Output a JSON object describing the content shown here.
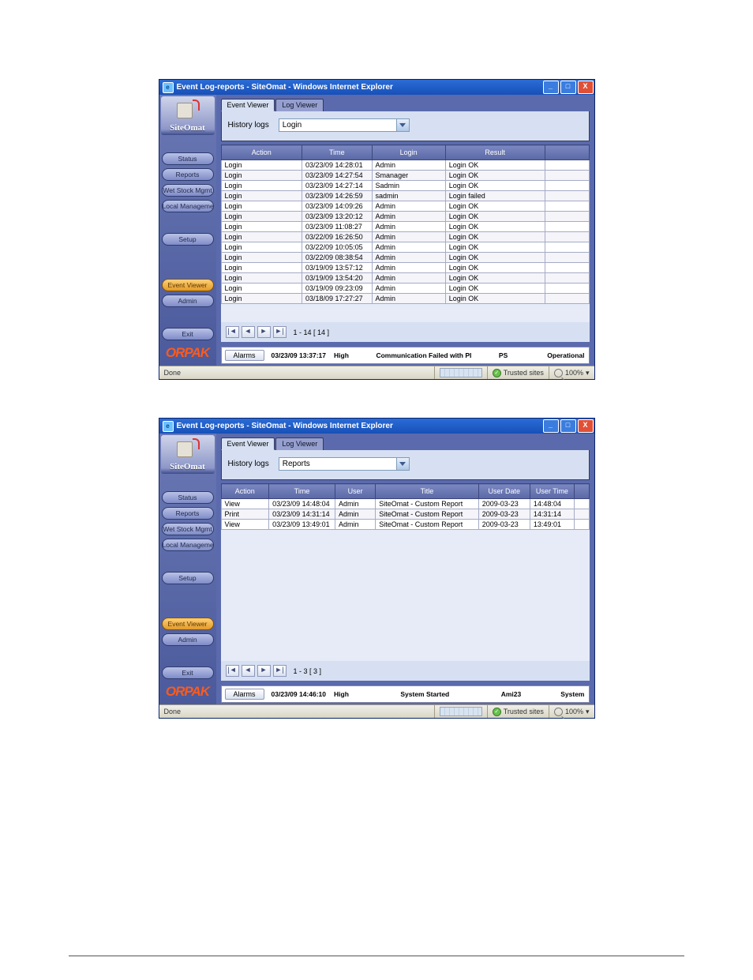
{
  "windowA": {
    "title": "Event Log-reports - SiteOmat - Windows Internet Explorer",
    "logo": "SiteOmat",
    "brand": "ORPAK",
    "nav": [
      "Status",
      "Reports",
      "Wet Stock Mgmt",
      "Local Management",
      "Setup",
      "Event Viewer",
      "Admin",
      "Exit"
    ],
    "navActiveIndex": 5,
    "tabs": [
      "Event Viewer",
      "Log Viewer"
    ],
    "tabActiveIndex": 0,
    "filterLabel": "History logs",
    "dropdownValue": "Login",
    "columns": [
      "Action",
      "Time",
      "Login",
      "Result"
    ],
    "rows": [
      [
        "Login",
        "03/23/09 14:28:01",
        "Admin",
        "Login OK"
      ],
      [
        "Login",
        "03/23/09 14:27:54",
        "Smanager",
        "Login OK"
      ],
      [
        "Login",
        "03/23/09 14:27:14",
        "Sadmin",
        "Login OK"
      ],
      [
        "Login",
        "03/23/09 14:26:59",
        "sadmin",
        "Login failed"
      ],
      [
        "Login",
        "03/23/09 14:09:26",
        "Admin",
        "Login OK"
      ],
      [
        "Login",
        "03/23/09 13:20:12",
        "Admin",
        "Login OK"
      ],
      [
        "Login",
        "03/23/09 11:08:27",
        "Admin",
        "Login OK"
      ],
      [
        "Login",
        "03/22/09 16:26:50",
        "Admin",
        "Login OK"
      ],
      [
        "Login",
        "03/22/09 10:05:05",
        "Admin",
        "Login OK"
      ],
      [
        "Login",
        "03/22/09 08:38:54",
        "Admin",
        "Login OK"
      ],
      [
        "Login",
        "03/19/09 13:57:12",
        "Admin",
        "Login OK"
      ],
      [
        "Login",
        "03/19/09 13:54:20",
        "Admin",
        "Login OK"
      ],
      [
        "Login",
        "03/19/09 09:23:09",
        "Admin",
        "Login OK"
      ],
      [
        "Login",
        "03/18/09 17:27:27",
        "Admin",
        "Login OK"
      ]
    ],
    "pager": {
      "first": "|◄",
      "prev": "◄",
      "next": "►",
      "last": "►|",
      "range": "1 - 14  [ 14 ]"
    },
    "alarm": {
      "btn": "Alarms",
      "time": "03/23/09 13:37:17",
      "sev": "High",
      "msg": "Communication Failed with PI",
      "dev": "PS",
      "cat": "Operational"
    },
    "ie": {
      "done": "Done",
      "trusted": "Trusted sites",
      "zoom": "100%"
    }
  },
  "windowB": {
    "title": "Event Log-reports - SiteOmat - Windows Internet Explorer",
    "logo": "SiteOmat",
    "brand": "ORPAK",
    "nav": [
      "Status",
      "Reports",
      "Wet Stock Mgmt",
      "Local Management",
      "Setup",
      "Event Viewer",
      "Admin",
      "Exit"
    ],
    "navActiveIndex": 5,
    "tabs": [
      "Event Viewer",
      "Log Viewer"
    ],
    "tabActiveIndex": 0,
    "filterLabel": "History logs",
    "dropdownValue": "Reports",
    "columns": [
      "Action",
      "Time",
      "User",
      "Title",
      "User Date",
      "User Time"
    ],
    "rows": [
      [
        "View",
        "03/23/09 14:48:04",
        "Admin",
        "SiteOmat - Custom Report",
        "2009-03-23",
        "14:48:04"
      ],
      [
        "Print",
        "03/23/09 14:31:14",
        "Admin",
        "SiteOmat - Custom Report",
        "2009-03-23",
        "14:31:14"
      ],
      [
        "View",
        "03/23/09 13:49:01",
        "Admin",
        "SiteOmat - Custom Report",
        "2009-03-23",
        "13:49:01"
      ]
    ],
    "pager": {
      "first": "|◄",
      "prev": "◄",
      "next": "►",
      "last": "►|",
      "range": "1 - 3  [ 3 ]"
    },
    "alarm": {
      "btn": "Alarms",
      "time": "03/23/09 14:46:10",
      "sev": "High",
      "msg": "System Started",
      "dev": "Ami23",
      "cat": "System"
    },
    "ie": {
      "done": "Done",
      "trusted": "Trusted sites",
      "zoom": "100%"
    }
  }
}
